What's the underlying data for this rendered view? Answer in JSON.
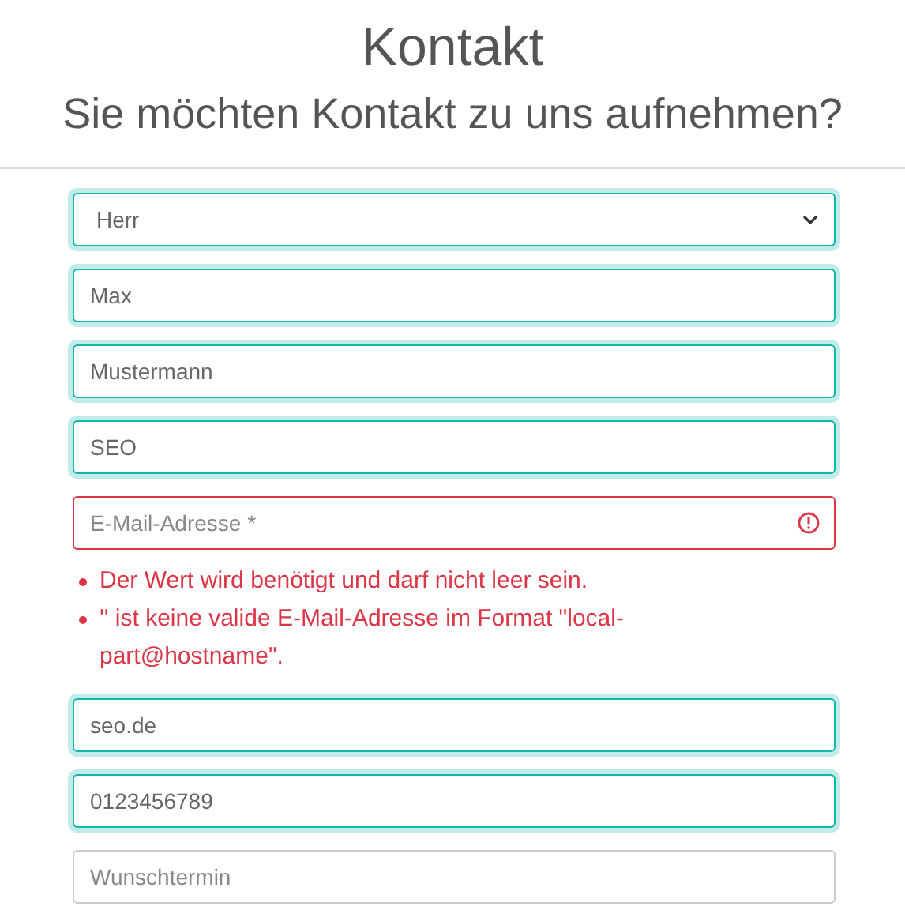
{
  "heading": {
    "title": "Kontakt",
    "subtitle": "Sie möchten Kontakt zu uns aufnehmen?"
  },
  "fields": [
    {
      "kind": "select",
      "value": "Herr",
      "highlighted": true,
      "invalid": false
    },
    {
      "kind": "text",
      "value": "Max",
      "highlighted": true,
      "invalid": false
    },
    {
      "kind": "text",
      "value": "Mustermann",
      "highlighted": true,
      "invalid": false
    },
    {
      "kind": "text",
      "value": "SEO",
      "highlighted": true,
      "invalid": false
    },
    {
      "kind": "text",
      "placeholder": "E-Mail-Adresse *",
      "highlighted": false,
      "invalid": true,
      "errors": [
        "Der Wert wird benötigt und darf nicht leer sein.",
        "'' ist keine valide E-Mail-Adresse im Format \"local-part@hostname\"."
      ]
    },
    {
      "kind": "text",
      "value": "seo.de",
      "highlighted": true,
      "invalid": false
    },
    {
      "kind": "text",
      "value": "0123456789",
      "highlighted": true,
      "invalid": false
    },
    {
      "kind": "text",
      "placeholder": "Wunschtermin",
      "highlighted": false,
      "invalid": false
    }
  ]
}
